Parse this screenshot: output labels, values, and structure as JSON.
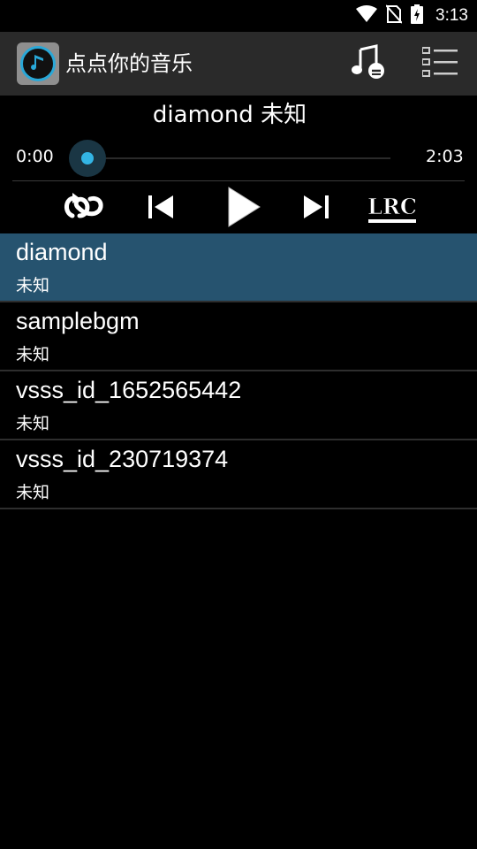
{
  "status_bar": {
    "time": "3:13",
    "icons": [
      "wifi-icon",
      "no-sim-icon",
      "battery-charging-icon"
    ]
  },
  "app_bar": {
    "title": "点点你的音乐",
    "logo_icon": "music-note-disc-icon",
    "music_button_icon": "music-note-minus-icon",
    "menu_button_icon": "list-menu-icon"
  },
  "player": {
    "song_title": "diamond  未知",
    "current_time": "0:00",
    "total_time": "2:03",
    "progress": 0.0,
    "controls": {
      "repeat_icon": "repeat-icon",
      "prev_icon": "skip-previous-icon",
      "play_icon": "play-icon",
      "next_icon": "skip-next-icon",
      "lrc_label": "LRC"
    }
  },
  "playlist": [
    {
      "name": "diamond",
      "artist": "未知",
      "selected": true
    },
    {
      "name": "samplebgm",
      "artist": "未知",
      "selected": false
    },
    {
      "name": "vsss_id_1652565442",
      "artist": "未知",
      "selected": false
    },
    {
      "name": "vsss_id_230719374",
      "artist": "未知",
      "selected": false
    }
  ],
  "colors": {
    "accent": "#33b5e5",
    "selected_row": "#26536f",
    "appbar": "#2a2a2a",
    "background": "#000000"
  }
}
